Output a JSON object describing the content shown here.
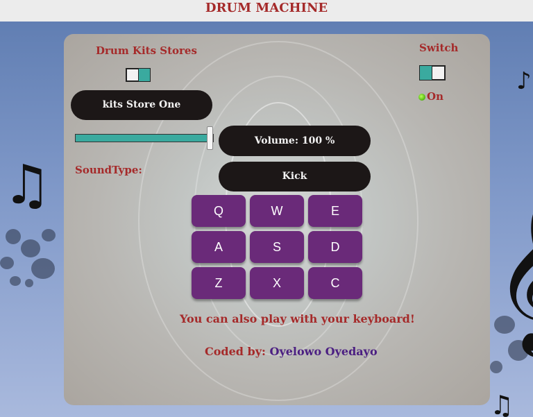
{
  "header": {
    "title": "DRUM MACHINE"
  },
  "kits": {
    "title": "Drum Kits Stores",
    "current": "kits Store One"
  },
  "power": {
    "title": "Switch",
    "status": "On"
  },
  "volume": {
    "level_percent": 100,
    "display": "Volume: 100 %"
  },
  "sound": {
    "label": "SoundType:",
    "display": "Kick"
  },
  "pads": [
    {
      "key": "Q"
    },
    {
      "key": "W"
    },
    {
      "key": "E"
    },
    {
      "key": "A"
    },
    {
      "key": "S"
    },
    {
      "key": "D"
    },
    {
      "key": "Z"
    },
    {
      "key": "X"
    },
    {
      "key": "C"
    }
  ],
  "footer": {
    "hint": "You can also play with your keyboard!",
    "credit_prefix": "Coded by:",
    "credit_name": "Oyelowo Oyedayo"
  },
  "colors": {
    "accent": "#3aaa9f",
    "pad": "#6a2a79",
    "label": "#a52a2a",
    "credit_name": "#4b1f82"
  }
}
